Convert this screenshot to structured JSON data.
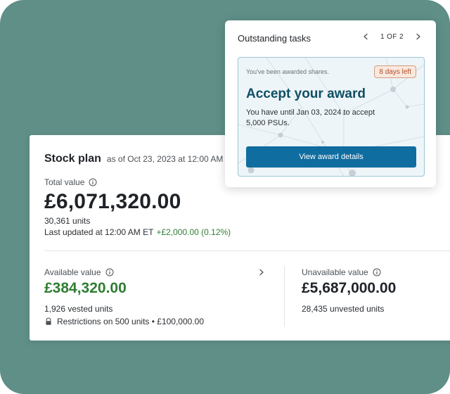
{
  "colors": {
    "background_teal": "#5f8f87",
    "primary_blue": "#0f6da0",
    "title_blue": "#0f4f66",
    "positive_green": "#2f7d32",
    "badge_bg": "#f9e8de",
    "badge_border": "#d39b7f",
    "badge_text": "#b04f2a"
  },
  "stock_plan": {
    "title": "Stock plan",
    "as_of": "as of Oct 23, 2023 at 12:00 AM ET",
    "total": {
      "label": "Total value",
      "info_icon": "info-icon",
      "value": "£6,071,320.00",
      "units": "30,361 units",
      "last_updated_prefix": "Last updated at 12:00 AM ET",
      "change": "+£2,000.00 (0.12%)"
    },
    "available": {
      "label": "Available value",
      "info_icon": "info-icon",
      "chevron_icon": "chevron-right-icon",
      "value": "£384,320.00",
      "vested_units": "1,926 vested units",
      "lock_icon": "lock-icon",
      "restrictions": "Restrictions on 500 units • £100,000.00"
    },
    "unavailable": {
      "label": "Unavailable value",
      "info_icon": "info-icon",
      "value": "£5,687,000.00",
      "unvested_units": "28,435 unvested units"
    }
  },
  "tasks": {
    "title": "Outstanding tasks",
    "pager": {
      "prev_icon": "chevron-left-icon",
      "text": "1 OF 2",
      "next_icon": "chevron-right-icon"
    },
    "award": {
      "kicker": "You've been awarded shares.",
      "badge": "8 days left",
      "title": "Accept your award",
      "description": "You have until Jan 03, 2024 to accept 5,000 PSUs.",
      "button_label": "View award details"
    }
  }
}
